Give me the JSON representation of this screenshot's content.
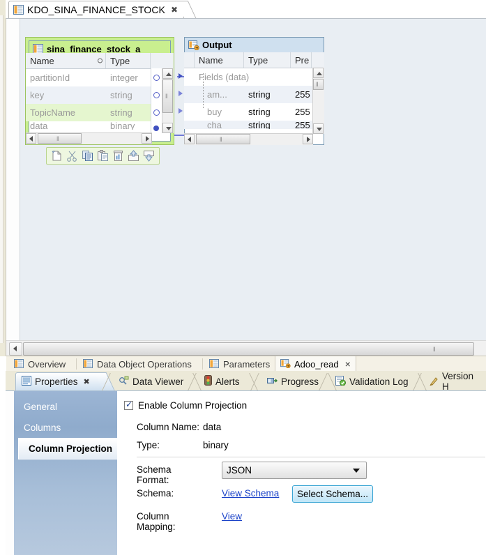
{
  "editor": {
    "tab_title": "KDO_SINA_FINANCE_STOCK",
    "tab_close": "✖",
    "icon": "data-object-icon"
  },
  "canvas": {
    "source_node": {
      "title": "sina_finance_stock_a",
      "icon": "table-icon",
      "columns": [
        "Name",
        "Type"
      ],
      "rows": [
        {
          "name": "partitionId",
          "type": "integer"
        },
        {
          "name": "key",
          "type": "string"
        },
        {
          "name": "TopicName",
          "type": "string"
        },
        {
          "name": "data",
          "type": "binary"
        }
      ],
      "scroll_grip": "‖"
    },
    "output_node": {
      "title": "Output",
      "icon": "output-port-icon",
      "columns": [
        "Name",
        "Type",
        "Pre"
      ],
      "rows": [
        {
          "name": "Fields (data)",
          "type": "",
          "precision": "",
          "group": true
        },
        {
          "name": "am...",
          "type": "string",
          "precision": "255"
        },
        {
          "name": "buy",
          "type": "string",
          "precision": "255"
        },
        {
          "name": "cha",
          "type": "string",
          "precision": "255"
        }
      ],
      "scroll_grip": "‖"
    },
    "node_toolbar": {
      "icons": [
        "new-icon",
        "cut-icon",
        "copy-icon",
        "paste-icon",
        "delete-icon",
        "export-icon",
        "import-icon"
      ]
    },
    "hscroll_grip": "‖"
  },
  "view_tabs": {
    "items": [
      {
        "label": "Overview",
        "icon": "data-object-icon",
        "selected": false,
        "closable": false
      },
      {
        "label": "Data Object Operations",
        "icon": "data-object-icon",
        "selected": false,
        "closable": false
      },
      {
        "label": "Parameters",
        "icon": "data-object-icon",
        "selected": false,
        "closable": false
      },
      {
        "label": "Adoo_read",
        "icon": "read-operation-icon",
        "selected": true,
        "closable": true
      }
    ],
    "close_glyph": "×"
  },
  "bottom_tabs": {
    "items": [
      {
        "label": "Properties",
        "icon": "properties-icon",
        "active": true,
        "closable": true
      },
      {
        "label": "Data Viewer",
        "icon": "data-viewer-icon",
        "active": false,
        "closable": false
      },
      {
        "label": "Alerts",
        "icon": "alerts-icon",
        "active": false,
        "closable": false
      },
      {
        "label": "Progress",
        "icon": "progress-icon",
        "active": false,
        "closable": false
      },
      {
        "label": "Validation Log",
        "icon": "validation-log-icon",
        "active": false,
        "closable": false
      },
      {
        "label": "Version H",
        "icon": "version-history-icon",
        "active": false,
        "closable": false
      }
    ],
    "close_glyph": "✖"
  },
  "properties": {
    "nav": [
      {
        "label": "General",
        "selected": false
      },
      {
        "label": "Columns",
        "selected": false
      },
      {
        "label": "Column Projection",
        "selected": true
      }
    ],
    "enable_column_projection": {
      "label": "Enable Column Projection",
      "checked": true
    },
    "fields": {
      "column_name_label": "Column Name:",
      "column_name_value": "data",
      "type_label": "Type:",
      "type_value": "binary",
      "schema_format_label": "Schema Format:",
      "schema_format_value": "JSON",
      "schema_label": "Schema:",
      "view_schema_link": "View Schema",
      "select_schema_button": "Select Schema...",
      "column_mapping_label": "Column Mapping:",
      "column_mapping_link": "View"
    }
  },
  "colors": {
    "selection_green": "#c9ef8f",
    "node_border_blue": "#7b9bb5",
    "link_blue": "#6f79d6",
    "link_color": "#1a42c8",
    "tab_active_blue": "#cfe0f0",
    "nav_blue": "#9cb5d4"
  }
}
